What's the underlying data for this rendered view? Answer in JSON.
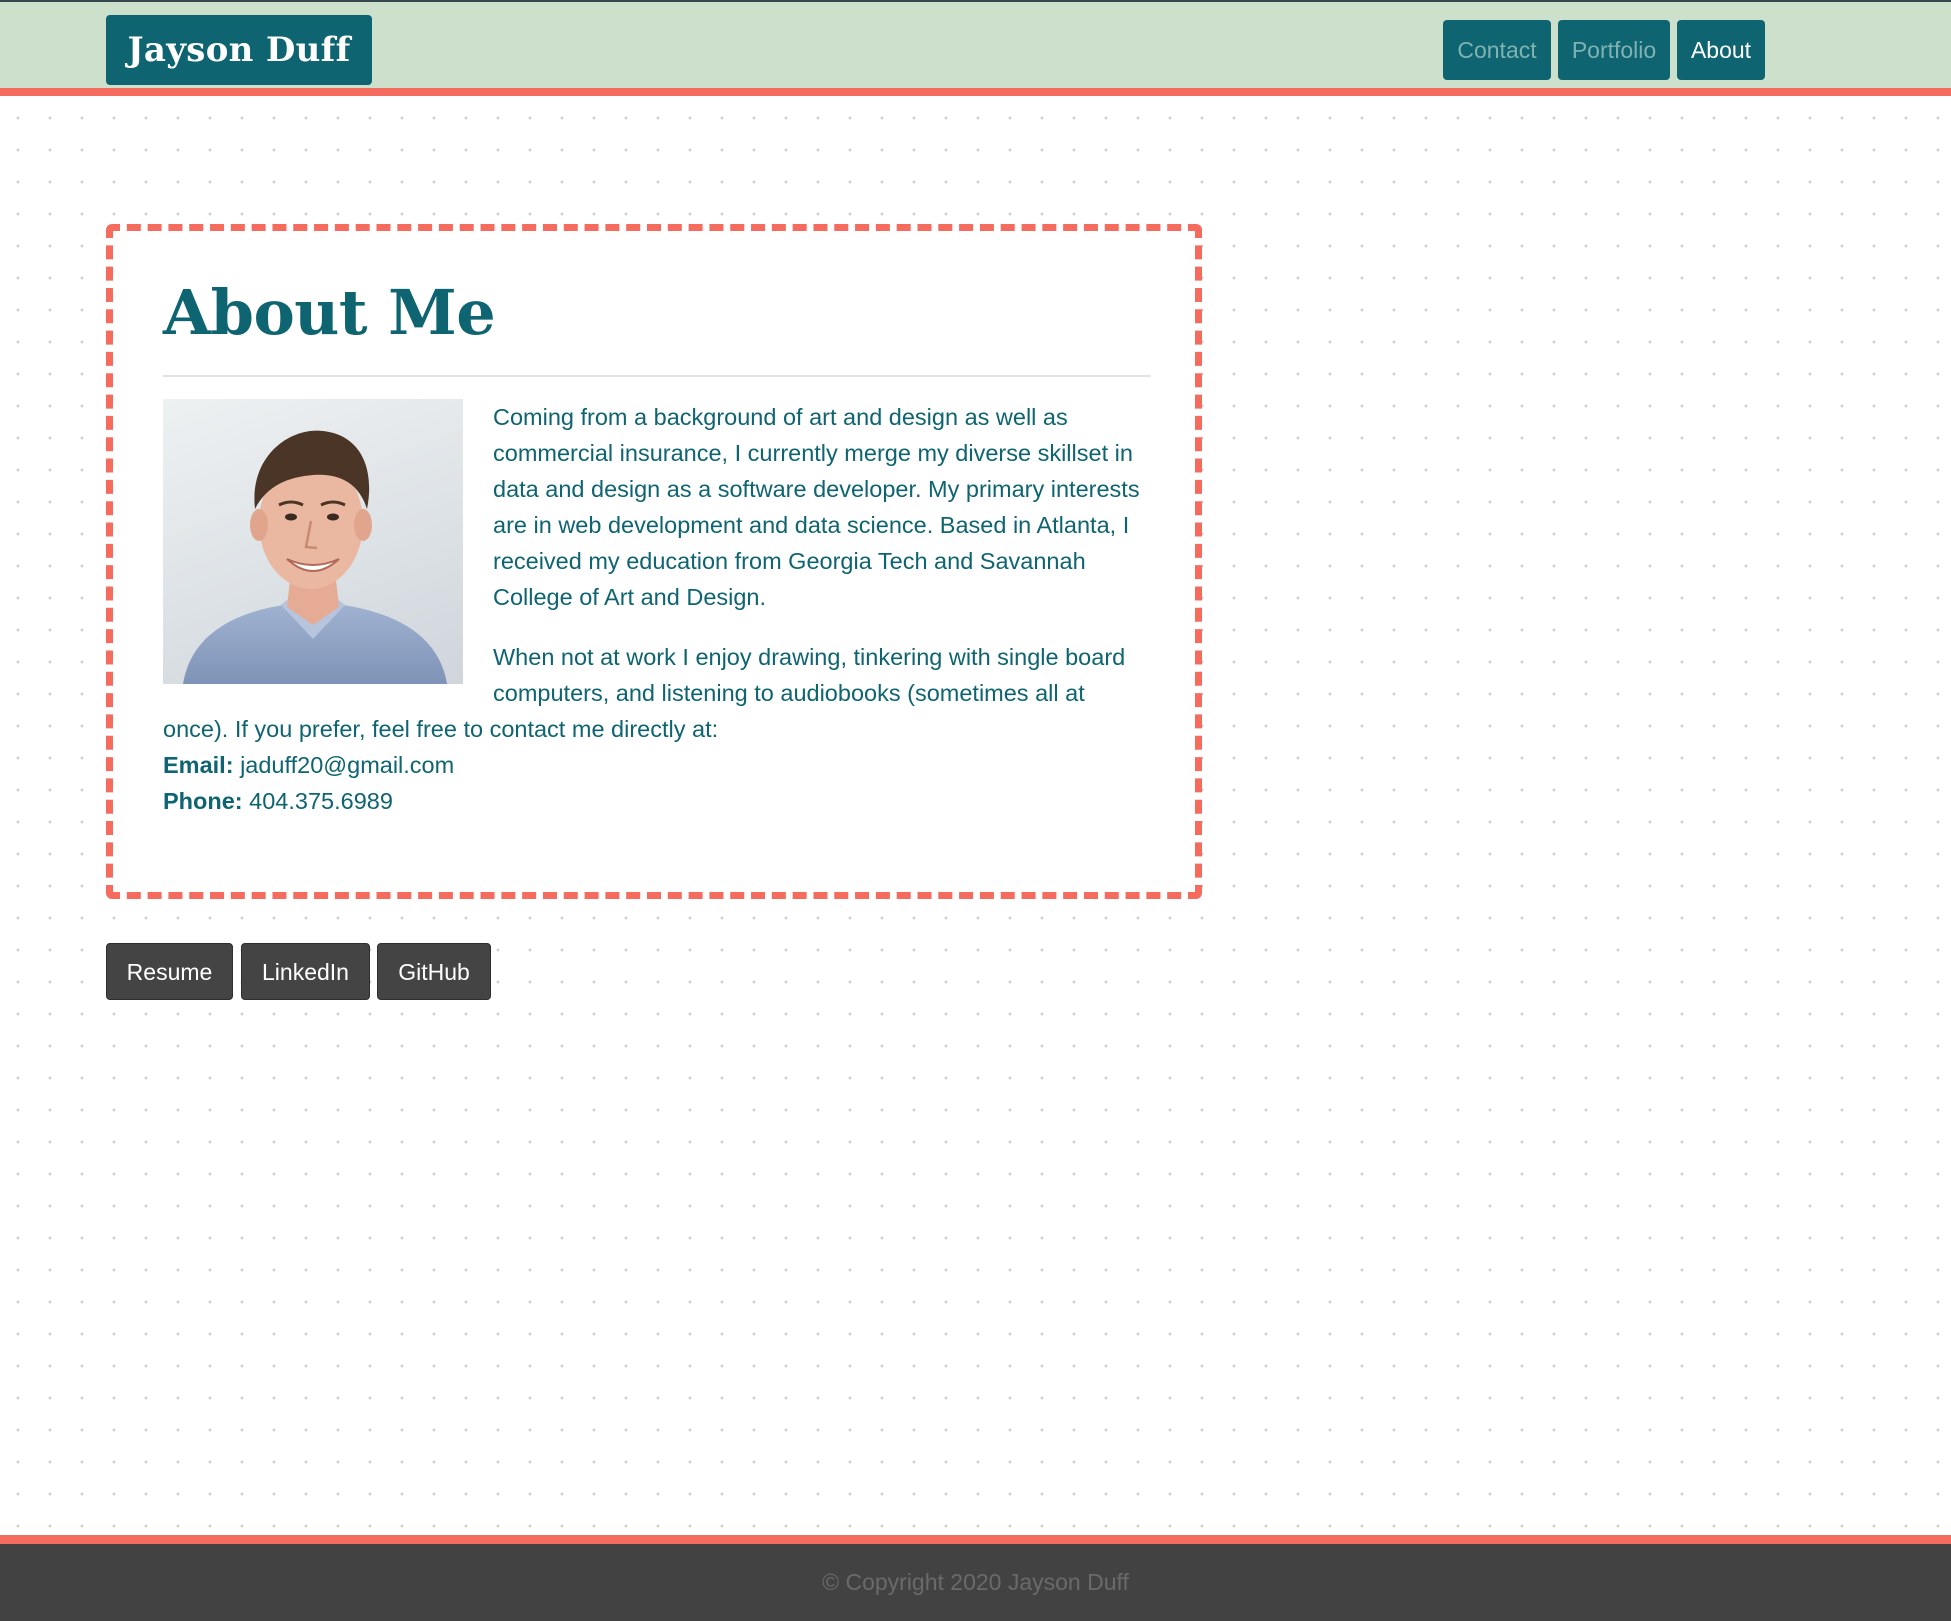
{
  "header": {
    "brand": "Jayson Duff",
    "nav": [
      {
        "label": "Contact"
      },
      {
        "label": "Portfolio"
      },
      {
        "label": "About",
        "active": true
      }
    ]
  },
  "about": {
    "title": "About Me",
    "photo_alt": "Photo of Jayson Duff",
    "paragraph1": "Coming from a background of art and design as well as commercial insurance, I currently merge my diverse skillset in data and design as a software developer. My primary interests are in web development and data science. Based in Atlanta, I received my education from Georgia Tech and Savannah College of Art and Design.",
    "paragraph2": "When not at work I enjoy drawing, tinkering with single board computers, and listening to audiobooks (sometimes all at once). If you prefer, feel free to contact me directly at:",
    "email_label": "Email:",
    "email": "jaduff20@gmail.com",
    "phone_label": "Phone:",
    "phone": "404.375.6989"
  },
  "links": [
    {
      "label": "Resume"
    },
    {
      "label": "LinkedIn"
    },
    {
      "label": "GitHub"
    }
  ],
  "footer": {
    "copyright": "© Copyright 2020 Jayson Duff"
  },
  "colors": {
    "header_bg": "#cde0cb",
    "brand_teal": "#0e6470",
    "accent_coral": "#f56c5f",
    "button_dark": "#444444",
    "footer_bg": "#424242"
  }
}
